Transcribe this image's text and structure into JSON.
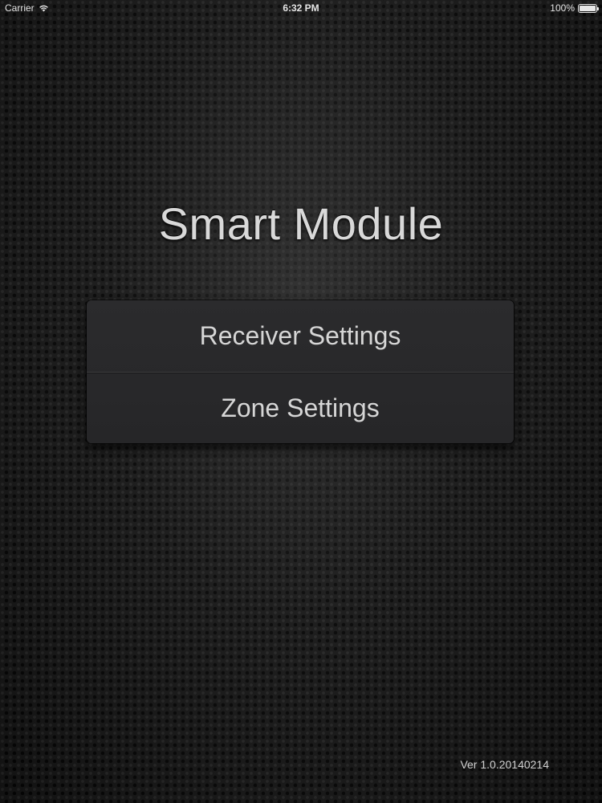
{
  "status_bar": {
    "carrier": "Carrier",
    "time": "6:32 PM",
    "battery_percent": "100%",
    "battery_level": 1.0,
    "icons": [
      "wifi-icon",
      "battery-icon"
    ]
  },
  "app": {
    "title": "Smart Module",
    "version": "Ver 1.0.20140214"
  },
  "menu": {
    "items": [
      {
        "label": "Receiver Settings"
      },
      {
        "label": "Zone Settings"
      }
    ]
  },
  "colors": {
    "background": "#1c1c1c",
    "panel": "#2a2a2c",
    "text": "#d6d6d6"
  }
}
